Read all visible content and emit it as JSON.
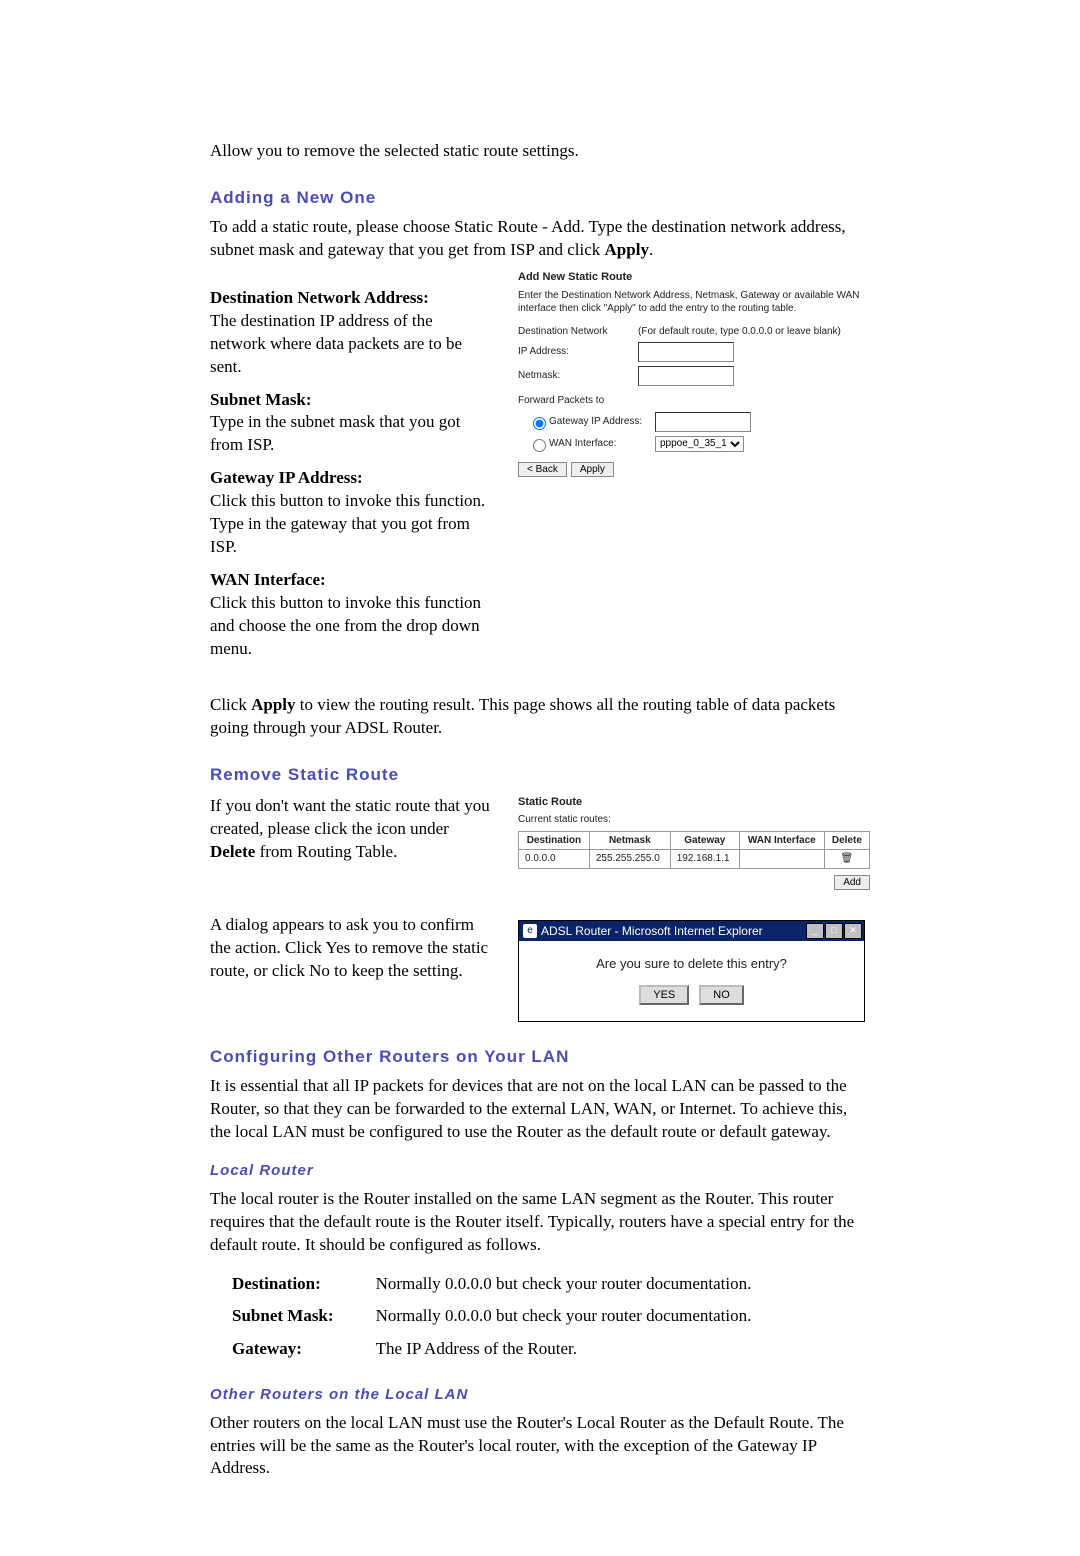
{
  "intro": "Allow you to remove the selected static route settings.",
  "sections": {
    "adding": {
      "title": "Adding a New One",
      "desc": "To add a static route, please choose Static Route - Add. Type the destination network address, subnet mask and gateway that you get from ISP and click ",
      "desc_bold": "Apply",
      "desc_end": ".",
      "defs": {
        "dna_t": "Destination Network Address:",
        "dna_d": "The destination IP address of the network where data packets are to be sent.",
        "sm_t": "Subnet Mask:",
        "sm_d": "Type in the subnet mask that you got from ISP.",
        "gw_t": "Gateway IP Address:",
        "gw_d": "Click this button to invoke this function. Type in the gateway that you got from ISP.",
        "wan_t": "WAN Interface:",
        "wan_d": "Click this button to invoke this function and choose the one from the drop down menu."
      },
      "panel": {
        "title": "Add New Static Route",
        "text": "Enter the Destination Network Address, Netmask, Gateway or available WAN interface then click \"Apply\" to add the entry to the routing table.",
        "dest_label": "Destination Network",
        "hint": "(For default route, type 0.0.0.0 or leave blank)",
        "ip_label": "IP Address:",
        "nm_label": "Netmask:",
        "fw_label": "Forward Packets to",
        "gw_radio": "Gateway IP Address:",
        "wan_radio": "WAN Interface:",
        "wan_option": "pppoe_0_35_1",
        "back": "< Back",
        "apply": "Apply"
      },
      "apply_note_pre": "Click ",
      "apply_note_bold": "Apply",
      "apply_note_post": " to view the routing result. This page shows all the routing table of data packets going through your ADSL Router."
    },
    "remove": {
      "title": "Remove Static Route",
      "para1_a": "If you don't want the static route that you created, please click the icon under ",
      "para1_b": "Delete",
      "para1_c": " from Routing Table.",
      "para2": "A dialog appears to ask you to confirm the action. Click Yes to remove the static route, or click No to keep the setting.",
      "table": {
        "title": "Static Route",
        "caption": "Current static routes:",
        "headers": [
          "Destination",
          "Netmask",
          "Gateway",
          "WAN Interface",
          "Delete"
        ],
        "row": {
          "dest": "0.0.0.0",
          "nm": "255.255.255.0",
          "gw": "192.168.1.1",
          "wan": "",
          "del": "🗑"
        },
        "add_btn": "Add"
      },
      "dialog": {
        "title": "ADSL Router - Microsoft Internet Explorer",
        "msg": "Are you sure to delete this entry?",
        "yes": "YES",
        "no": "NO"
      }
    },
    "config": {
      "title": "Configuring Other Routers on Your LAN",
      "para": "It is essential that all IP packets for devices that are not on the local LAN can be passed to the Router, so that they can be forwarded to the external LAN, WAN, or Internet. To achieve this, the local LAN must be configured to use the Router as the default route or default gateway.",
      "local": {
        "title": "Local Router",
        "para": "The local router is the Router installed on the same LAN segment as the Router. This router requires that the default route is the Router itself. Typically, routers have a special entry for the default route. It should be configured as follows.",
        "rows": {
          "d_l": "Destination:",
          "d_v": "Normally 0.0.0.0 but check your router documentation.",
          "s_l": "Subnet Mask:",
          "s_v": "Normally 0.0.0.0 but check your router documentation.",
          "g_l": "Gateway:",
          "g_v": "The IP Address of the Router."
        }
      },
      "other": {
        "title": "Other Routers on the Local LAN",
        "para": "Other routers on the local LAN must use the Router's Local Router as the Default Route. The entries will be the same as the Router's local router, with the exception of the Gateway IP Address."
      }
    }
  }
}
